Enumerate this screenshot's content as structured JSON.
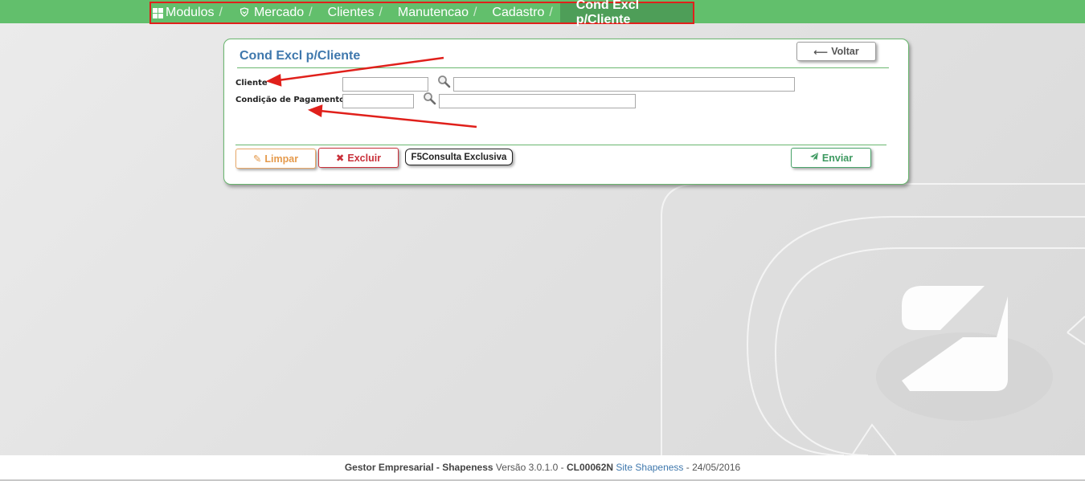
{
  "breadcrumb": {
    "items": [
      {
        "label": "Modulos",
        "icon": "grid-icon"
      },
      {
        "label": "Mercado",
        "icon": "shield-icon"
      },
      {
        "label": "Clientes"
      },
      {
        "label": "Manutencao"
      },
      {
        "label": "Cadastro"
      }
    ],
    "separator": "/",
    "current": "Cond Excl p/Cliente"
  },
  "panel": {
    "title": "Cond Excl p/Cliente",
    "back_button": "Voltar",
    "fields": {
      "cliente": {
        "label": "Cliente",
        "code_value": "",
        "name_value": ""
      },
      "condicao": {
        "label": "Condição de Pagamento",
        "code_value": "",
        "name_value": ""
      }
    },
    "buttons": {
      "limpar": "Limpar",
      "excluir": "Excluir",
      "consulta_key": "F5",
      "consulta": "Consulta Exclusiva",
      "enviar": "Enviar"
    }
  },
  "footer": {
    "product": "Gestor Empresarial - Shapeness",
    "version": "Versão 3.0.1.0 -",
    "code": "CL00062N",
    "link": "Site Shapeness",
    "date": "- 24/05/2016"
  },
  "colors": {
    "nav_green": "#62bf6c",
    "active_crumb": "#4e9e58",
    "highlight_box": "#e0201b",
    "title_blue": "#3f78ad",
    "limpar_orange": "#e59a4c",
    "excluir_red": "#c9303a",
    "enviar_green": "#3d9960",
    "annotation_arrow": "#e0201b"
  }
}
